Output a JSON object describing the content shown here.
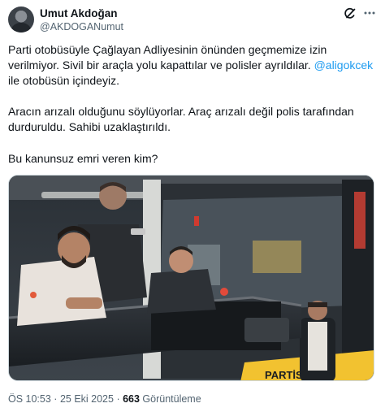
{
  "author": {
    "name": "Umut Akdoğan",
    "handle": "@AKDOGANumut"
  },
  "icons": {
    "header": [
      "grok-icon",
      "more-options-icon"
    ],
    "avatar": "profile-photo"
  },
  "tweet": {
    "para1_before": "Parti otobüsüyle Çağlayan Adliyesinin önünden geçmemize izin verilmiyor. Sivil bir araçla yolu kapattılar ve polisler ayrıldılar. ",
    "mention": "@aligokcek",
    "para1_after": " ile otobüsün içindeyiz.",
    "para2": "Aracın arızalı olduğunu söylüyorlar. Araç arızalı değil polis tarafından durduruldu. Sahibi uzaklaştırıldı.",
    "para3": "Bu kanunsuz emri veren kim?"
  },
  "media": {
    "bus_sign_text": "PARTİSİ"
  },
  "footer": {
    "time": "ÖS 10:53",
    "separator": " · ",
    "date": "25 Eki 2025",
    "views_count": "663",
    "views_label": " Görüntüleme"
  },
  "colors": {
    "link": "#1d9bf0",
    "secondary_text": "#536471",
    "primary_text": "#0f1419",
    "bus_sign": "#f2c230"
  }
}
